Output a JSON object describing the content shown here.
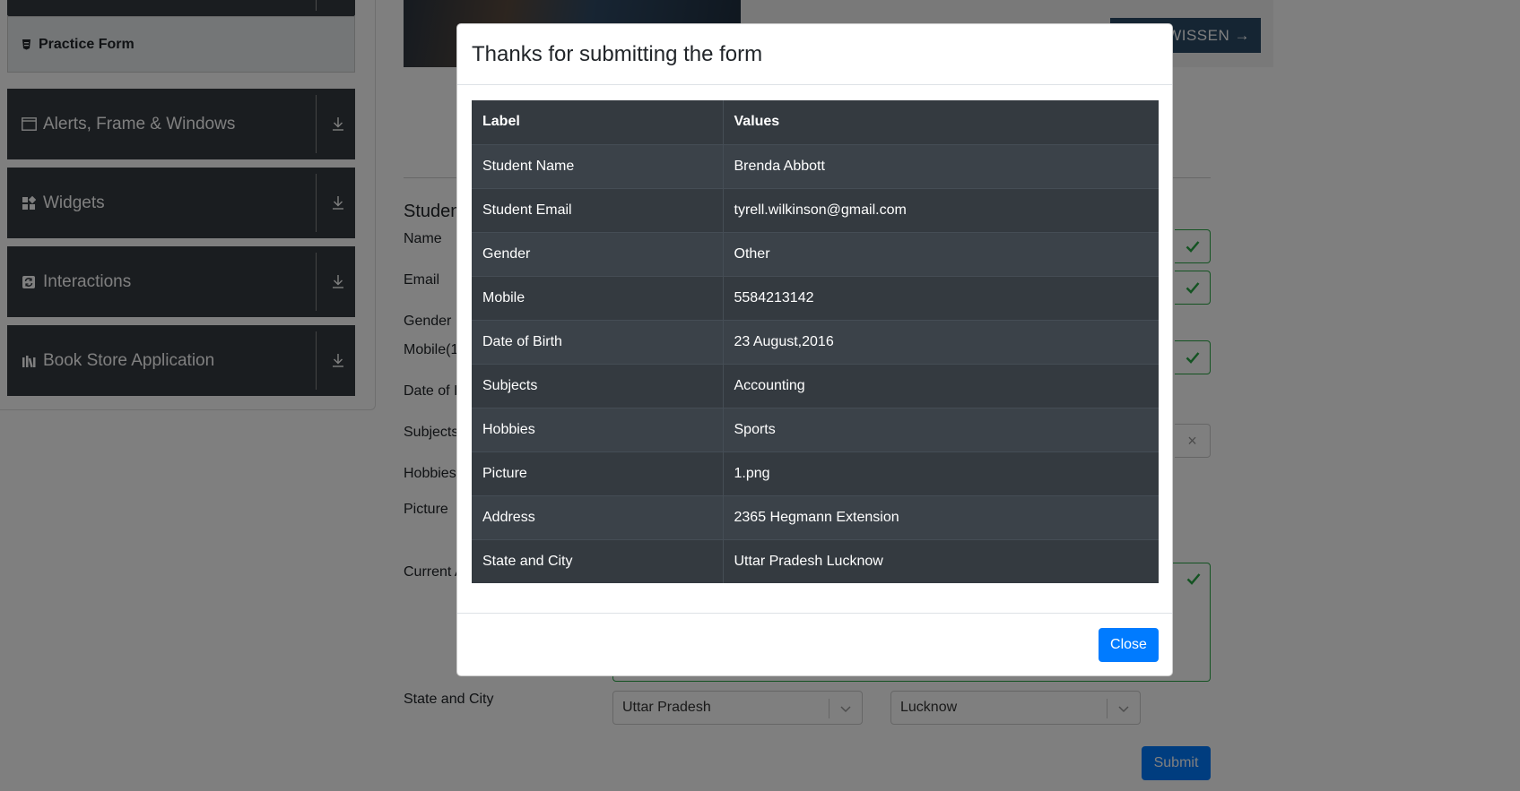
{
  "sidebar": {
    "practice_form": "Practice Form",
    "groups": [
      {
        "label": "Alerts, Frame & Windows",
        "icon": "window-icon"
      },
      {
        "label": "Widgets",
        "icon": "widgets-icon"
      },
      {
        "label": "Interactions",
        "icon": "interactions-icon"
      },
      {
        "label": "Book Store Application",
        "icon": "books-icon"
      }
    ]
  },
  "background": {
    "ad_button": "WISSEN →",
    "form_title": "Studen",
    "labels": {
      "name": "Name",
      "email": "Email",
      "gender": "Gender",
      "mobile": "Mobile(1",
      "dob": "Date of I",
      "subjects": "Subjects",
      "hobbies": "Hobbies",
      "picture": "Picture",
      "address": "Current A",
      "state_city": "State and City"
    },
    "state_value": "Uttar Pradesh",
    "city_value": "Lucknow",
    "submit": "Submit"
  },
  "modal": {
    "title": "Thanks for submitting the form",
    "header_label": "Label",
    "header_values": "Values",
    "rows": [
      {
        "label": "Student Name",
        "value": "Brenda Abbott"
      },
      {
        "label": "Student Email",
        "value": "tyrell.wilkinson@gmail.com"
      },
      {
        "label": "Gender",
        "value": "Other"
      },
      {
        "label": "Mobile",
        "value": "5584213142"
      },
      {
        "label": "Date of Birth",
        "value": "23 August,2016"
      },
      {
        "label": "Subjects",
        "value": "Accounting"
      },
      {
        "label": "Hobbies",
        "value": "Sports"
      },
      {
        "label": "Picture",
        "value": "1.png"
      },
      {
        "label": "Address",
        "value": "2365 Hegmann Extension"
      },
      {
        "label": "State and City",
        "value": "Uttar Pradesh Lucknow"
      }
    ],
    "close": "Close"
  },
  "colors": {
    "sidebar_group_bg": "#343a40",
    "table_bg": "#343a40",
    "primary": "#007bff",
    "success": "#28a745"
  }
}
